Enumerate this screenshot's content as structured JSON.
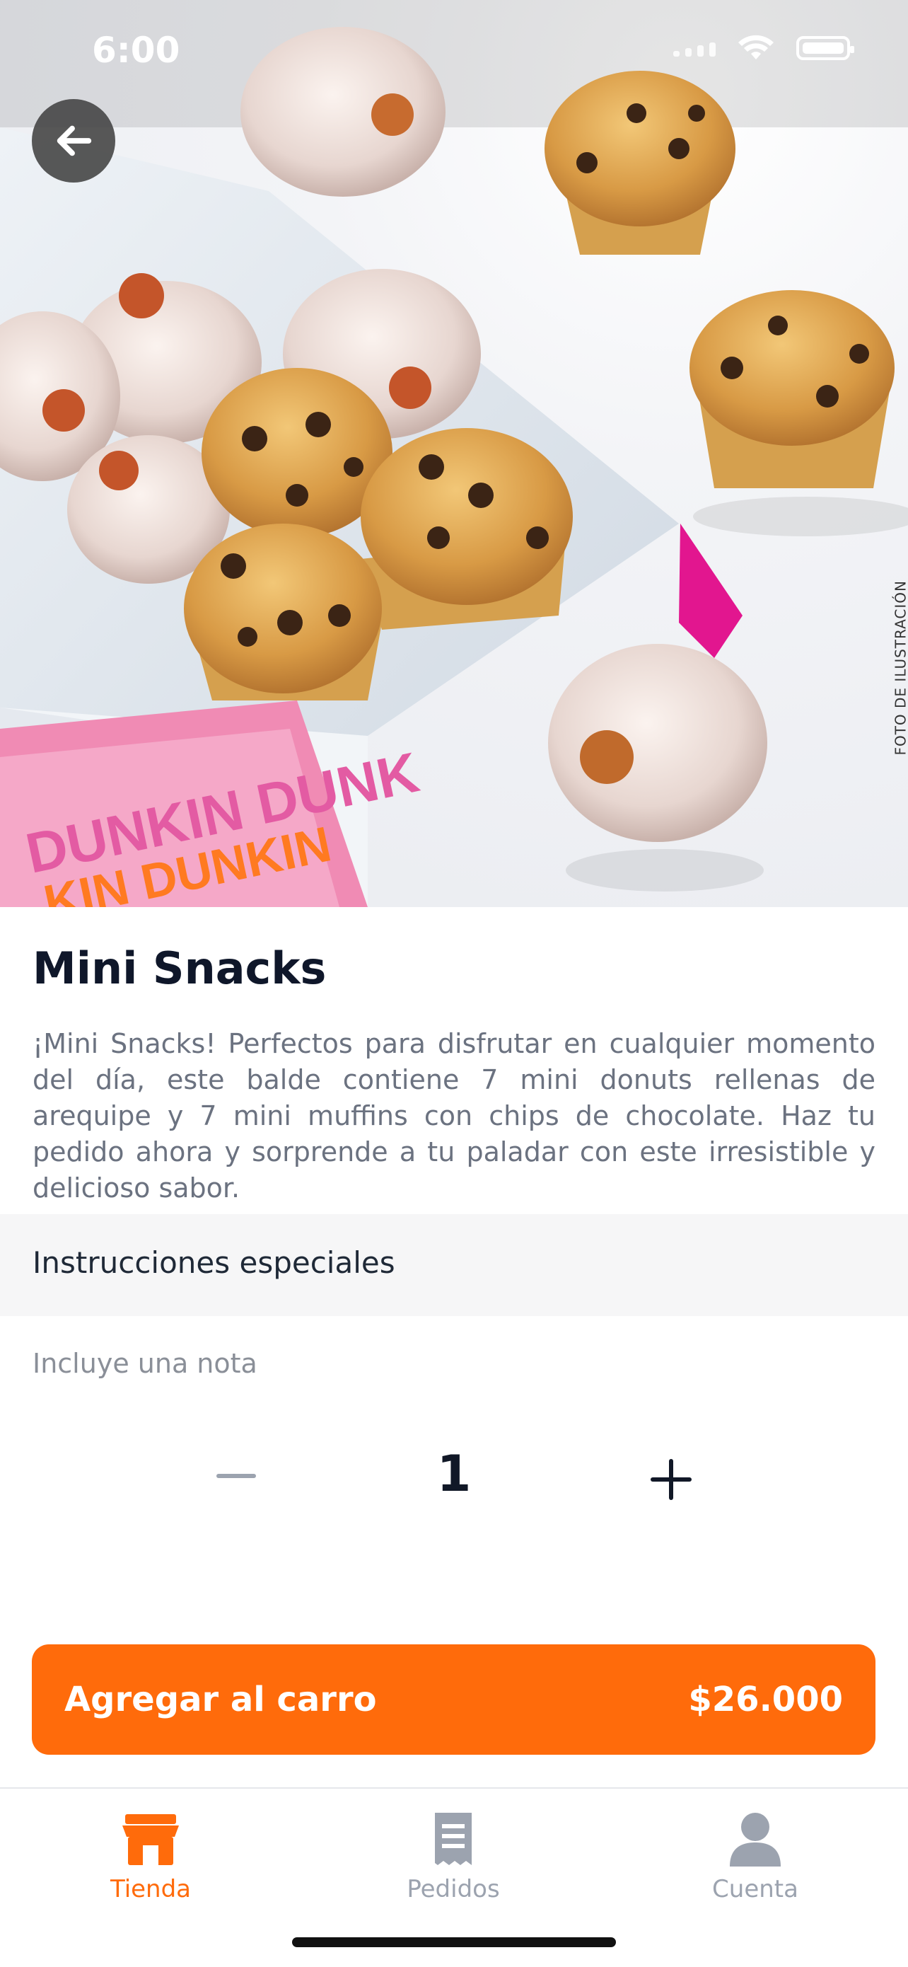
{
  "status_bar": {
    "time": "6:00"
  },
  "hero": {
    "caption": "FOTO DE ILUSTRACIÓN",
    "back_icon": "arrow-left-icon"
  },
  "product": {
    "title": "Mini Snacks",
    "description": "¡Mini Snacks! Perfectos para disfrutar en cualquier momento del día, este balde contiene 7 mini donuts rellenas de arequipe y 7 mini muffins con chips de chocolate. Haz tu pedido ahora y sorprende a tu paladar con este irresistible y delicioso sabor."
  },
  "special_instructions": {
    "header": "Instrucciones especiales",
    "placeholder": "Incluye una nota"
  },
  "quantity": {
    "value": "1"
  },
  "cta": {
    "label": "Agregar al carro",
    "price": "$26.000",
    "color": "#ff6b0b"
  },
  "tabbar": {
    "items": [
      {
        "label": "Tienda",
        "icon": "store-icon",
        "active": true,
        "color": "#ff6b0b"
      },
      {
        "label": "Pedidos",
        "icon": "receipt-icon",
        "active": false,
        "color": "#9ca3af"
      },
      {
        "label": "Cuenta",
        "icon": "user-icon",
        "active": false,
        "color": "#9ca3af"
      }
    ]
  }
}
